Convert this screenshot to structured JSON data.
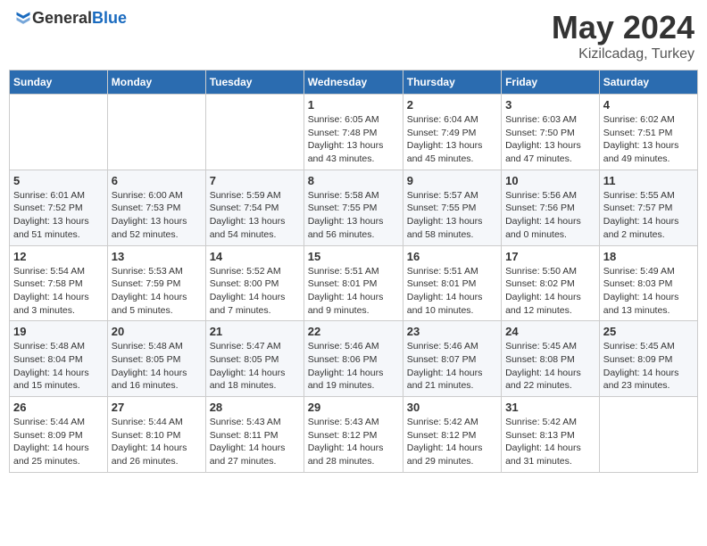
{
  "header": {
    "logo_general": "General",
    "logo_blue": "Blue",
    "month": "May 2024",
    "location": "Kizilcadag, Turkey"
  },
  "weekdays": [
    "Sunday",
    "Monday",
    "Tuesday",
    "Wednesday",
    "Thursday",
    "Friday",
    "Saturday"
  ],
  "weeks": [
    [
      {
        "day": "",
        "info": ""
      },
      {
        "day": "",
        "info": ""
      },
      {
        "day": "",
        "info": ""
      },
      {
        "day": "1",
        "info": "Sunrise: 6:05 AM\nSunset: 7:48 PM\nDaylight: 13 hours\nand 43 minutes."
      },
      {
        "day": "2",
        "info": "Sunrise: 6:04 AM\nSunset: 7:49 PM\nDaylight: 13 hours\nand 45 minutes."
      },
      {
        "day": "3",
        "info": "Sunrise: 6:03 AM\nSunset: 7:50 PM\nDaylight: 13 hours\nand 47 minutes."
      },
      {
        "day": "4",
        "info": "Sunrise: 6:02 AM\nSunset: 7:51 PM\nDaylight: 13 hours\nand 49 minutes."
      }
    ],
    [
      {
        "day": "5",
        "info": "Sunrise: 6:01 AM\nSunset: 7:52 PM\nDaylight: 13 hours\nand 51 minutes."
      },
      {
        "day": "6",
        "info": "Sunrise: 6:00 AM\nSunset: 7:53 PM\nDaylight: 13 hours\nand 52 minutes."
      },
      {
        "day": "7",
        "info": "Sunrise: 5:59 AM\nSunset: 7:54 PM\nDaylight: 13 hours\nand 54 minutes."
      },
      {
        "day": "8",
        "info": "Sunrise: 5:58 AM\nSunset: 7:55 PM\nDaylight: 13 hours\nand 56 minutes."
      },
      {
        "day": "9",
        "info": "Sunrise: 5:57 AM\nSunset: 7:55 PM\nDaylight: 13 hours\nand 58 minutes."
      },
      {
        "day": "10",
        "info": "Sunrise: 5:56 AM\nSunset: 7:56 PM\nDaylight: 14 hours\nand 0 minutes."
      },
      {
        "day": "11",
        "info": "Sunrise: 5:55 AM\nSunset: 7:57 PM\nDaylight: 14 hours\nand 2 minutes."
      }
    ],
    [
      {
        "day": "12",
        "info": "Sunrise: 5:54 AM\nSunset: 7:58 PM\nDaylight: 14 hours\nand 3 minutes."
      },
      {
        "day": "13",
        "info": "Sunrise: 5:53 AM\nSunset: 7:59 PM\nDaylight: 14 hours\nand 5 minutes."
      },
      {
        "day": "14",
        "info": "Sunrise: 5:52 AM\nSunset: 8:00 PM\nDaylight: 14 hours\nand 7 minutes."
      },
      {
        "day": "15",
        "info": "Sunrise: 5:51 AM\nSunset: 8:01 PM\nDaylight: 14 hours\nand 9 minutes."
      },
      {
        "day": "16",
        "info": "Sunrise: 5:51 AM\nSunset: 8:01 PM\nDaylight: 14 hours\nand 10 minutes."
      },
      {
        "day": "17",
        "info": "Sunrise: 5:50 AM\nSunset: 8:02 PM\nDaylight: 14 hours\nand 12 minutes."
      },
      {
        "day": "18",
        "info": "Sunrise: 5:49 AM\nSunset: 8:03 PM\nDaylight: 14 hours\nand 13 minutes."
      }
    ],
    [
      {
        "day": "19",
        "info": "Sunrise: 5:48 AM\nSunset: 8:04 PM\nDaylight: 14 hours\nand 15 minutes."
      },
      {
        "day": "20",
        "info": "Sunrise: 5:48 AM\nSunset: 8:05 PM\nDaylight: 14 hours\nand 16 minutes."
      },
      {
        "day": "21",
        "info": "Sunrise: 5:47 AM\nSunset: 8:05 PM\nDaylight: 14 hours\nand 18 minutes."
      },
      {
        "day": "22",
        "info": "Sunrise: 5:46 AM\nSunset: 8:06 PM\nDaylight: 14 hours\nand 19 minutes."
      },
      {
        "day": "23",
        "info": "Sunrise: 5:46 AM\nSunset: 8:07 PM\nDaylight: 14 hours\nand 21 minutes."
      },
      {
        "day": "24",
        "info": "Sunrise: 5:45 AM\nSunset: 8:08 PM\nDaylight: 14 hours\nand 22 minutes."
      },
      {
        "day": "25",
        "info": "Sunrise: 5:45 AM\nSunset: 8:09 PM\nDaylight: 14 hours\nand 23 minutes."
      }
    ],
    [
      {
        "day": "26",
        "info": "Sunrise: 5:44 AM\nSunset: 8:09 PM\nDaylight: 14 hours\nand 25 minutes."
      },
      {
        "day": "27",
        "info": "Sunrise: 5:44 AM\nSunset: 8:10 PM\nDaylight: 14 hours\nand 26 minutes."
      },
      {
        "day": "28",
        "info": "Sunrise: 5:43 AM\nSunset: 8:11 PM\nDaylight: 14 hours\nand 27 minutes."
      },
      {
        "day": "29",
        "info": "Sunrise: 5:43 AM\nSunset: 8:12 PM\nDaylight: 14 hours\nand 28 minutes."
      },
      {
        "day": "30",
        "info": "Sunrise: 5:42 AM\nSunset: 8:12 PM\nDaylight: 14 hours\nand 29 minutes."
      },
      {
        "day": "31",
        "info": "Sunrise: 5:42 AM\nSunset: 8:13 PM\nDaylight: 14 hours\nand 31 minutes."
      },
      {
        "day": "",
        "info": ""
      }
    ]
  ]
}
